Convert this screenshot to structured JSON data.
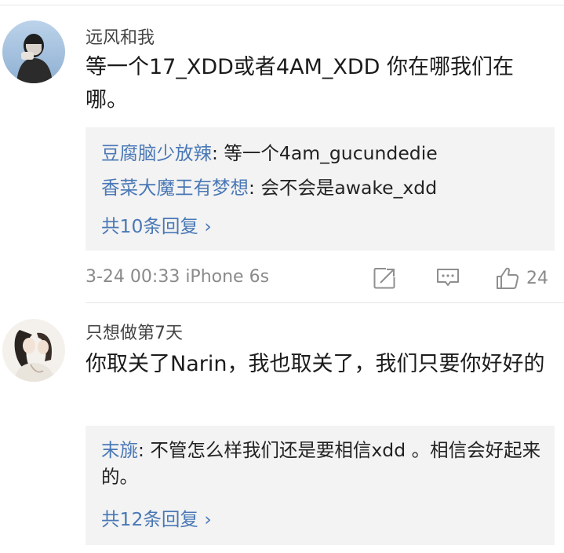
{
  "comments": [
    {
      "username": "远风和我",
      "content": "等一个17_XDD或者4AM_XDD 你在哪我们在哪。",
      "replies": [
        {
          "author": "豆腐脑少放辣",
          "text": ": 等一个4am_gucundedie"
        },
        {
          "author": "香菜大魔王有梦想",
          "text": ": 会不会是awake_xdd"
        }
      ],
      "more_replies": "共10条回复 ›",
      "timestamp": "3-24 00:33  iPhone 6s",
      "like_count": "24"
    },
    {
      "username": "只想做第7天",
      "content": "你取关了Narin，我也取关了，我们只要你好好的",
      "replies": [
        {
          "author": "末旐",
          "text": ": 不管怎么样我们还是要相信xdd 。相信会好起来的。"
        }
      ],
      "more_replies": "共12条回复 ›"
    }
  ],
  "icons": {
    "repost": "repost-icon",
    "comment": "comment-icon",
    "like": "thumbs-up-icon"
  },
  "colors": {
    "link": "#4a78b6",
    "reply_background": "#f3f3f3",
    "meta_text": "#8a8a8a"
  }
}
